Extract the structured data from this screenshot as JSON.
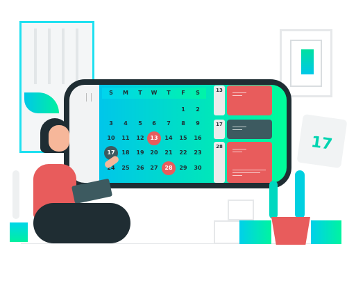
{
  "calendar": {
    "weekdays": [
      "S",
      "M",
      "T",
      "W",
      "T",
      "F",
      "S"
    ],
    "weeks": [
      [
        "",
        "",
        "",
        "",
        "",
        "1",
        "2"
      ],
      [
        "3",
        "4",
        "5",
        "6",
        "7",
        "8",
        "9"
      ],
      [
        "10",
        "11",
        "12",
        "13",
        "14",
        "15",
        "16"
      ],
      [
        "17",
        "18",
        "19",
        "20",
        "21",
        "22",
        "23"
      ],
      [
        "24",
        "25",
        "26",
        "27",
        "28",
        "29",
        "30"
      ]
    ],
    "highlighted_red": [
      "13",
      "28"
    ],
    "highlighted_dark": [
      "17"
    ]
  },
  "events": [
    {
      "date": "13",
      "color": "#e85c5c"
    },
    {
      "date": "17",
      "color": "#3d5a60"
    },
    {
      "date": "28",
      "color": "#e85c5c"
    }
  ],
  "wall_calendar": {
    "date": "17"
  },
  "colors": {
    "accent_start": "#00c6ea",
    "accent_end": "#00fc9a",
    "red": "#e85c5c",
    "dark": "#1f2d33"
  }
}
